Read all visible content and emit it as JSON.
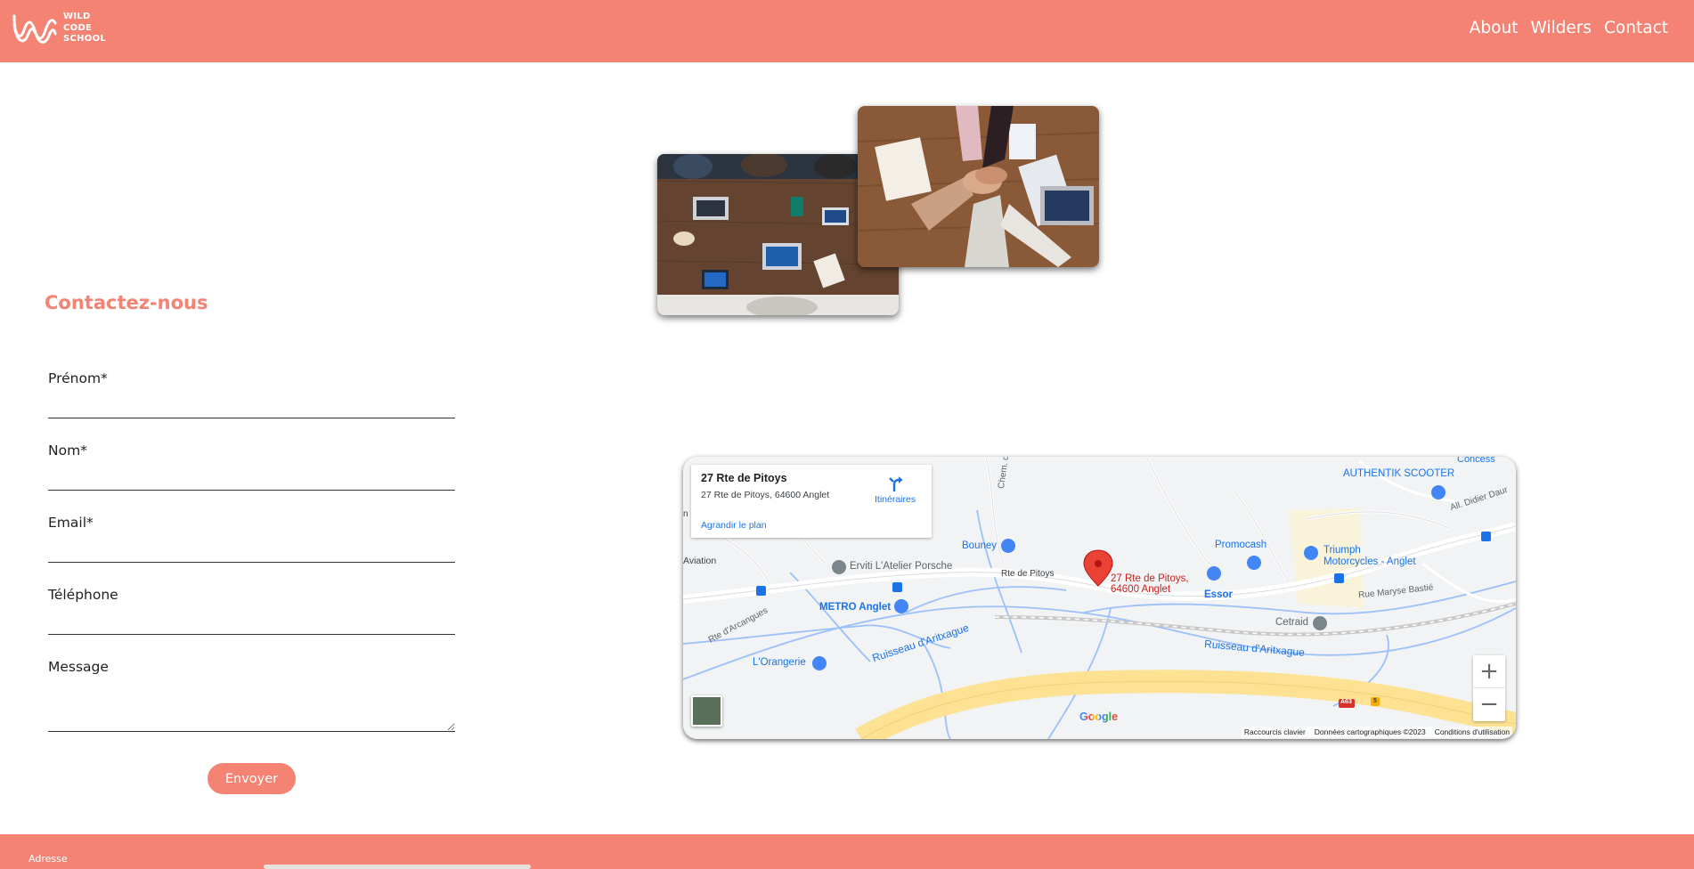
{
  "header": {
    "logo_lines": [
      "WILD",
      "CODE",
      "SCHOOL"
    ],
    "nav": [
      "About",
      "Wilders",
      "Contact"
    ]
  },
  "form": {
    "title": "Contactez-nous",
    "fields": [
      {
        "label": "Prénom*",
        "value": ""
      },
      {
        "label": "Nom*",
        "value": ""
      },
      {
        "label": "Email*",
        "value": ""
      },
      {
        "label": "Téléphone",
        "value": ""
      },
      {
        "label": "Message",
        "value": ""
      }
    ],
    "submit": "Envoyer"
  },
  "map": {
    "card_title": "27 Rte de Pitoys",
    "card_address": "27 Rte de Pitoys, 64600 Anglet",
    "directions": "Itinéraires",
    "enlarge": "Agrandir le plan",
    "pin_line1": "27 Rte de Pitoys,",
    "pin_line2": "64600 Anglet",
    "labels": {
      "concess": "Concess",
      "authentik": "AUTHENTIK SCOOTER",
      "didier": "All. Didier Daur",
      "chem": "Chem. de la Carriè",
      "bouney": "Bouney",
      "promocash": "Promocash",
      "triumph1": "Triumph",
      "triumph2": "Motorcycles - Anglet",
      "aviation": "Aviation",
      "erviti": "Erviti L'Atelier Porsche",
      "rte_pitoys": "Rte de Pitoys",
      "essor": "Essor",
      "maryse": "Rue Maryse Bastié",
      "metro": "METRO Anglet",
      "cetraid": "Cetraid",
      "arcangues": "Rte d'Arcangues",
      "ruisseau1": "Ruisseau d'Aritxague",
      "ruisseau2": "Ruisseau d'Aritxague",
      "orangerie": "L'Orangerie",
      "a63": "A63",
      "five": "5",
      "edge_m": "n"
    },
    "google": "Google",
    "attribution": [
      "Raccourcis clavier",
      "Données cartographiques ©2023",
      "Conditions d'utilisation"
    ],
    "zoom_in": "+",
    "zoom_out": "−"
  },
  "footer": {
    "label": "Adresse"
  },
  "colors": {
    "brand": "#f48373",
    "link_blue": "#1a73e8",
    "pin_red": "#ea4335"
  }
}
